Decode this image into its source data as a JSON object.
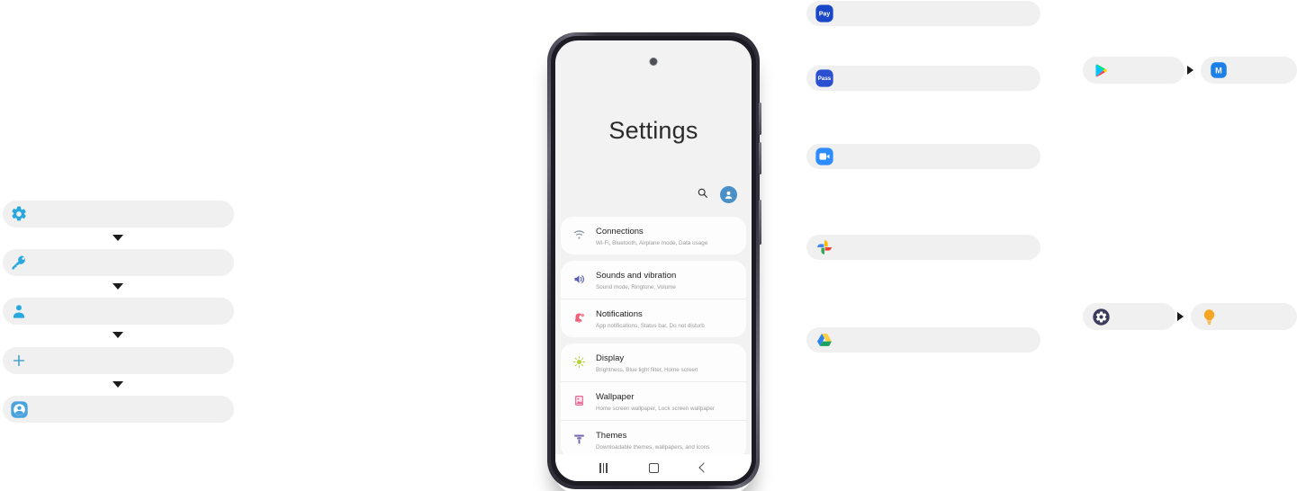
{
  "colors": {
    "pill_bg": "#f0f0f0",
    "accent_blue": "#4aa3dd",
    "samsung_blue": "#1a47c9",
    "zoom_blue": "#2d8cff",
    "card_bg": "#fdfdfd",
    "screen_bg": "#f2f2f2",
    "arrow": "#1b1b1b",
    "gear_navy": "#3b3c5c",
    "bulb_orange": "#f5a623"
  },
  "left_column": {
    "items": [
      {
        "icon": "gear-icon",
        "label": ""
      },
      {
        "icon": "key-icon",
        "label": ""
      },
      {
        "icon": "person-icon",
        "label": ""
      },
      {
        "icon": "plus-icon",
        "label": ""
      },
      {
        "icon": "account-circle-icon",
        "label": ""
      }
    ],
    "separators": [
      {
        "icon": "chevron-down-icon"
      },
      {
        "icon": "chevron-down-icon"
      },
      {
        "icon": "chevron-down-icon"
      },
      {
        "icon": "chevron-down-icon"
      }
    ]
  },
  "middle_column": {
    "items": [
      {
        "icon": "google-pay-icon",
        "badge_text": "Pay",
        "label": ""
      },
      {
        "icon": "samsung-pass-icon",
        "badge_text": "Pass",
        "label": ""
      },
      {
        "icon": "zoom-icon",
        "label": ""
      },
      {
        "icon": "google-photos-icon",
        "label": ""
      },
      {
        "icon": "google-drive-icon",
        "label": ""
      }
    ]
  },
  "right_pairs": [
    {
      "from": {
        "icon": "google-play-icon",
        "label": ""
      },
      "arrow": "arrow-right-icon",
      "to": {
        "icon": "members-m-icon",
        "badge_text": "M",
        "label": ""
      }
    },
    {
      "from": {
        "icon": "settings-gear-icon",
        "label": ""
      },
      "arrow": "arrow-right-icon",
      "to": {
        "icon": "lightbulb-icon",
        "label": ""
      }
    }
  ],
  "phone": {
    "device": "android-phone",
    "camera": "punch-hole-camera",
    "settings": {
      "title": "Settings",
      "actions": [
        {
          "icon": "search-icon",
          "name": "search-button"
        },
        {
          "icon": "account-avatar-icon",
          "name": "profile-button"
        }
      ],
      "groups": [
        {
          "rows": [
            {
              "icon": "wifi-icon",
              "title": "Connections",
              "subtitle": "Wi-Fi, Bluetooth, Airplane mode, Data usage"
            }
          ]
        },
        {
          "rows": [
            {
              "icon": "volume-icon",
              "title": "Sounds and vibration",
              "subtitle": "Sound mode, Ringtone, Volume"
            },
            {
              "icon": "notifications-icon",
              "title": "Notifications",
              "subtitle": "App notifications, Status bar, Do not disturb"
            }
          ]
        },
        {
          "rows": [
            {
              "icon": "brightness-icon",
              "title": "Display",
              "subtitle": "Brightness, Blue light filter, Home screen"
            },
            {
              "icon": "wallpaper-icon",
              "title": "Wallpaper",
              "subtitle": "Home screen wallpaper, Lock screen wallpaper"
            },
            {
              "icon": "themes-icon",
              "title": "Themes",
              "subtitle": "Downloadable themes, wallpapers, and icons"
            }
          ]
        }
      ]
    },
    "nav_bar": [
      {
        "icon": "recents-icon",
        "name": "recents-button"
      },
      {
        "icon": "home-icon",
        "name": "home-button"
      },
      {
        "icon": "back-icon",
        "name": "back-button"
      }
    ]
  }
}
